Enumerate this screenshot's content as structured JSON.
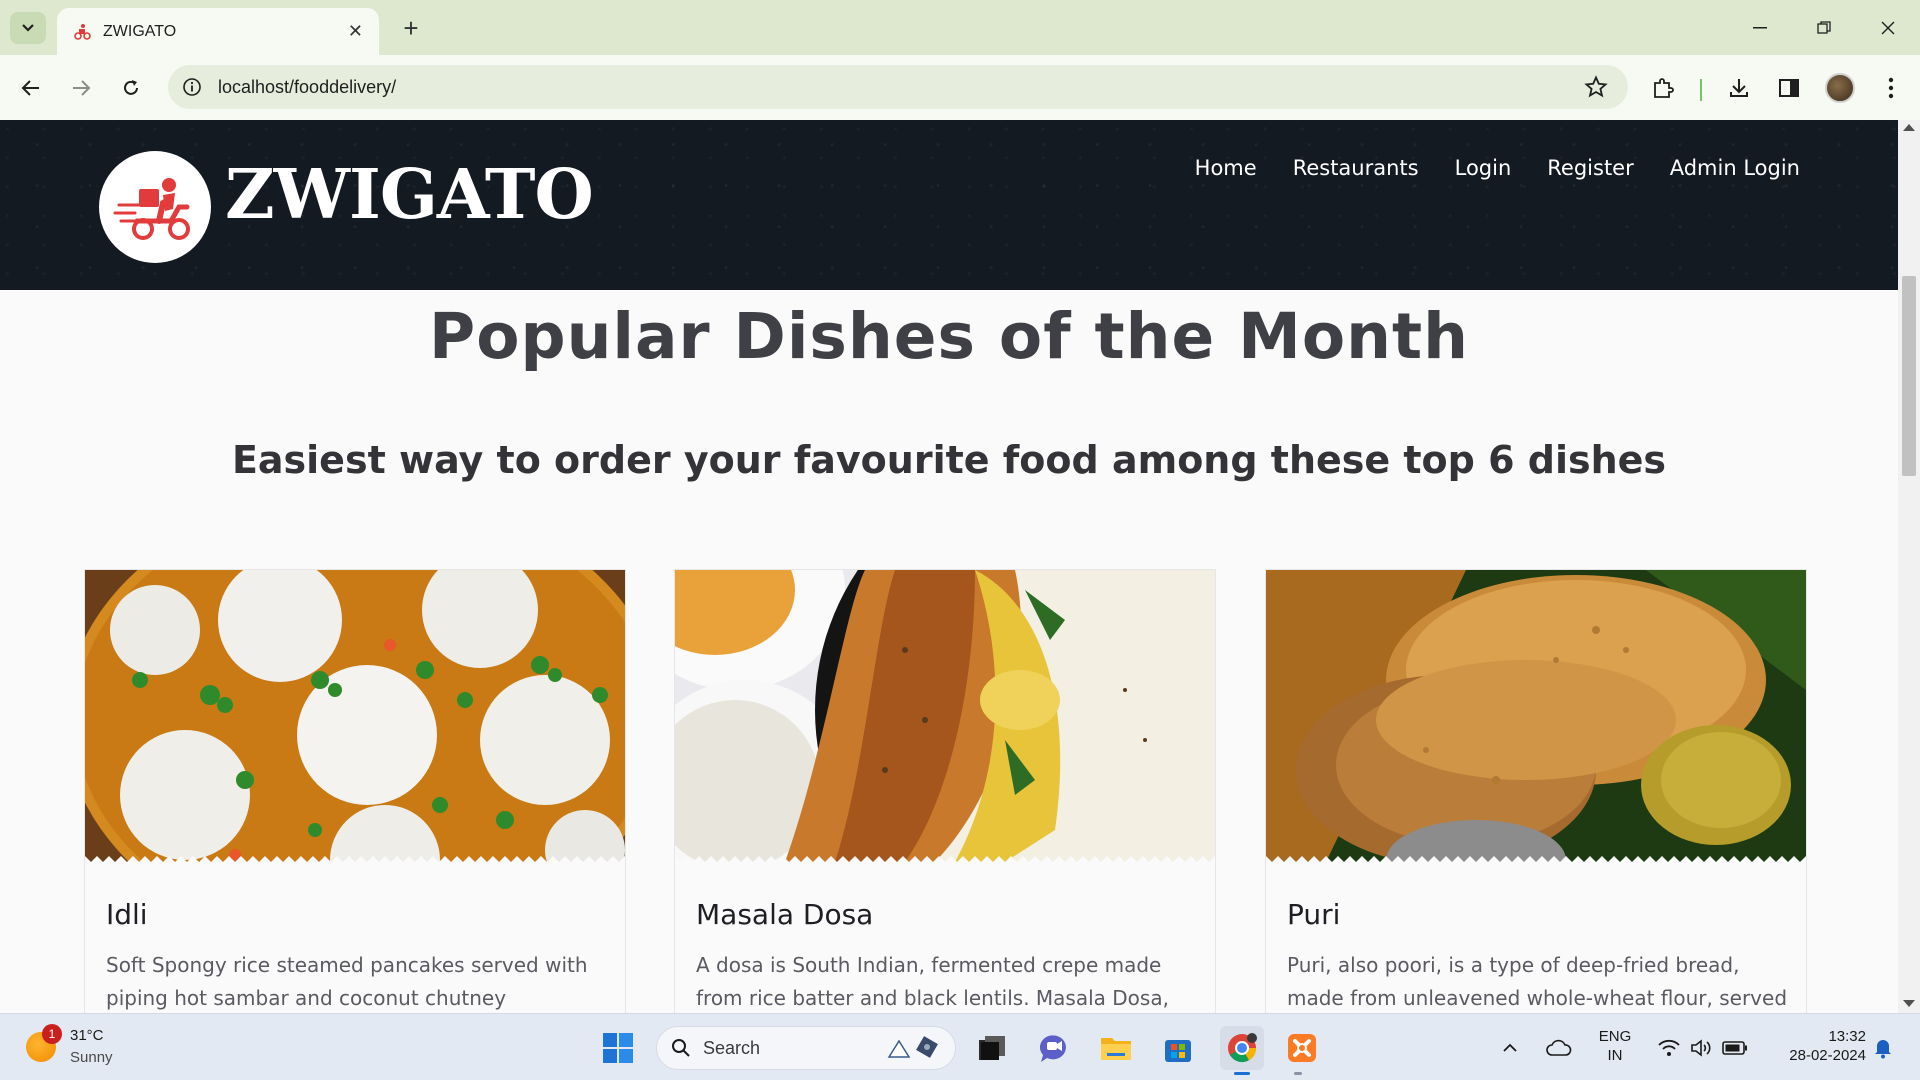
{
  "browser": {
    "tab_title": "ZWIGATO",
    "url": "localhost/fooddelivery/"
  },
  "site": {
    "brand": "ZWIGATO",
    "nav": [
      "Home",
      "Restaurants",
      "Login",
      "Register",
      "Admin Login"
    ],
    "title": "Popular Dishes of the Month",
    "subtitle": "Easiest way to order your favourite food among these top 6 dishes"
  },
  "dishes": [
    {
      "name": "Idli",
      "description": "Soft Spongy rice steamed pancakes served with piping hot sambar and coconut chutney"
    },
    {
      "name": "Masala Dosa",
      "description": "A dosa is South Indian, fermented crepe made from rice batter and black lentils. Masala Dosa,"
    },
    {
      "name": "Puri",
      "description": "Puri, also poori, is a type of deep-fried bread, made from unleavened whole-wheat flour, served"
    }
  ],
  "taskbar": {
    "weather_badge": "1",
    "temperature": "31°C",
    "condition": "Sunny",
    "search_label": "Search",
    "language_line1": "ENG",
    "language_line2": "IN",
    "time": "13:32",
    "date": "28-02-2024"
  },
  "colors": {
    "header_bg": "#141a22",
    "tab_bar_bg": "#dde8cf",
    "brand_red": "#e23b3b",
    "taskbar_bg": "#e3e9f2"
  }
}
